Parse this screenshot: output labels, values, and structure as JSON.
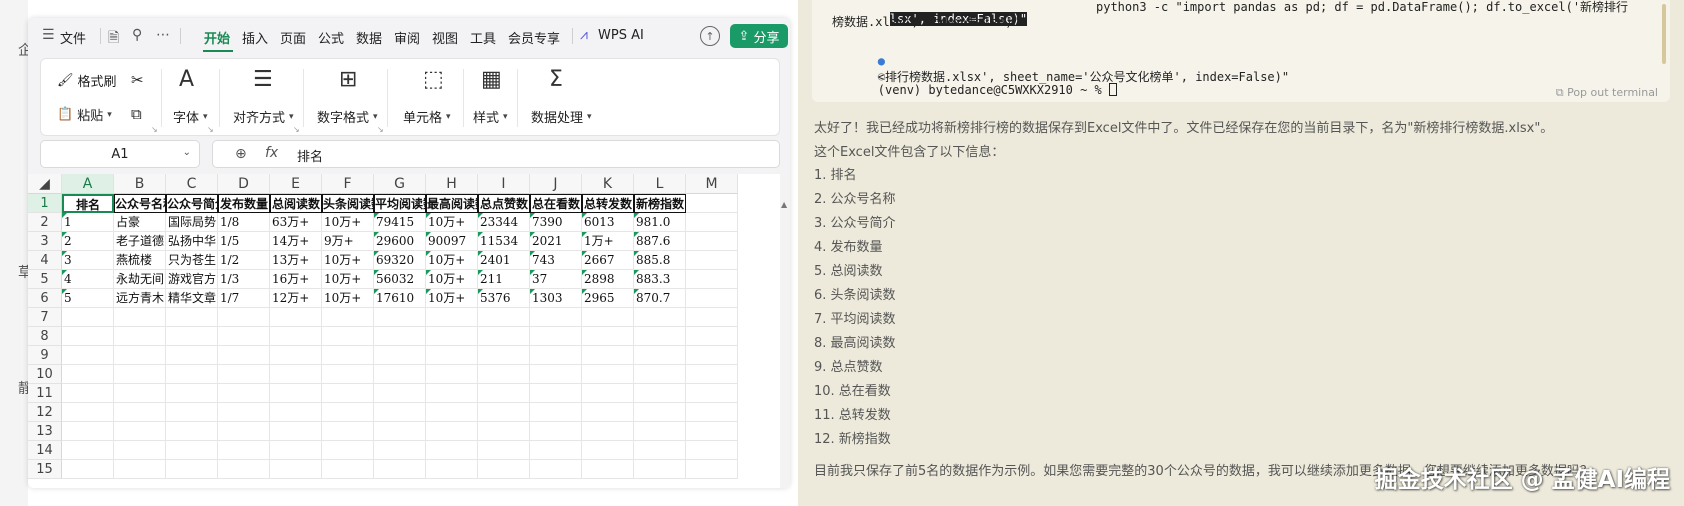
{
  "left_strip": {
    "chars": [
      "企",
      "草",
      "靜"
    ]
  },
  "wps": {
    "menu": {
      "file": "文件",
      "tabs": [
        "开始",
        "插入",
        "页面",
        "公式",
        "数据",
        "审阅",
        "视图",
        "工具",
        "会员专享"
      ],
      "active_tab": "开始",
      "wps_ai": "WPS AI",
      "share": "分享"
    },
    "ribbon": {
      "format_painter": "格式刷",
      "paste": "粘贴",
      "font": "字体",
      "alignment": "对齐方式",
      "number_format": "数字格式",
      "cell": "单元格",
      "style": "样式",
      "data_processing": "数据处理"
    },
    "formula": {
      "name_box": "A1",
      "fx": "fx",
      "value": "排名"
    },
    "columns": [
      "A",
      "B",
      "C",
      "D",
      "E",
      "F",
      "G",
      "H",
      "I",
      "J",
      "K",
      "L",
      "M"
    ],
    "rows": [
      "1",
      "2",
      "3",
      "4",
      "5",
      "6",
      "7",
      "8",
      "9",
      "10",
      "11",
      "12",
      "13",
      "14",
      "15"
    ],
    "header_row": [
      "排名",
      "公众号名称",
      "公众号简介",
      "发布数量",
      "总阅读数",
      "头条阅读数",
      "平均阅读数",
      "最高阅读数",
      "总点赞数",
      "总在看数",
      "总转发数",
      "新榜指数"
    ],
    "data_rows": [
      [
        "1",
        "占豪",
        "国际局势",
        "1/8",
        "63万+",
        "10万+",
        "79415",
        "10万+",
        "23344",
        "7390",
        "6013",
        "981.0"
      ],
      [
        "2",
        "老子道德",
        "弘扬中华",
        "1/5",
        "14万+",
        "9万+",
        "29600",
        "90097",
        "11534",
        "2021",
        "1万+",
        "887.6"
      ],
      [
        "3",
        "燕梳楼",
        "只为苍生",
        "1/2",
        "13万+",
        "10万+",
        "69320",
        "10万+",
        "2401",
        "743",
        "2667",
        "885.8"
      ],
      [
        "4",
        "永劫无间",
        "游戏官方",
        "1/3",
        "16万+",
        "10万+",
        "56032",
        "10万+",
        "211",
        "37",
        "2898",
        "883.3"
      ],
      [
        "5",
        "远方青木",
        "精华文章",
        "1/7",
        "12万+",
        "10万+",
        "17610",
        "10万+",
        "5376",
        "1303",
        "2965",
        "870.7"
      ]
    ]
  },
  "terminal": {
    "line1_highlight": "lsx', index=False)\"",
    "line1_rest": "python3 -c \"import pandas as pd; df = pd.DataFrame(); df.to_excel('新榜排行",
    "line2": "榜数据.xlsx', index=False)\"",
    "line3": "<排行榜数据.xlsx', sheet_name='公众号文化榜单', index=False)\"",
    "line4": "(venv) bytedance@C5WXKX2910 ~ % ",
    "pop_out": "Pop out terminal"
  },
  "assistant": {
    "intro": "太好了！我已经成功将新榜排行榜的数据保存到Excel文件中了。文件已经保存在您的当前目录下，名为\"新榜排行榜数据.xlsx\"。",
    "contains": "这个Excel文件包含了以下信息：",
    "items": [
      "1. 排名",
      "2. 公众号名称",
      "3. 公众号简介",
      "4. 发布数量",
      "5. 总阅读数",
      "6. 头条阅读数",
      "7. 平均阅读数",
      "8. 最高阅读数",
      "9. 总点赞数",
      "10. 总在看数",
      "11. 总转发数",
      "12. 新榜指数"
    ],
    "footer": "目前我只保存了前5名的数据作为示例。如果您需要完整的30个公众号的数据，我可以继续添加更多数据。您想要继续添加更多数据吗？"
  },
  "watermark": "掘金技术社区 @ 孟健AI编程"
}
